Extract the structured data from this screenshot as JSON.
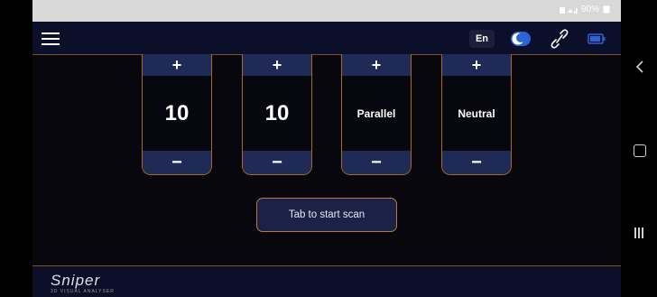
{
  "status_bar": {
    "status_text": "90%"
  },
  "app_bar": {
    "language": "En"
  },
  "tiles": [
    {
      "plus": "+",
      "value": "10",
      "minus": "−"
    },
    {
      "plus": "+",
      "value": "10",
      "minus": "−"
    },
    {
      "plus": "+",
      "value": "Parallel",
      "minus": "−"
    },
    {
      "plus": "+",
      "value": "Neutral",
      "minus": "−"
    }
  ],
  "scan_button": {
    "label": "Tab to start scan"
  },
  "footer": {
    "logo_name": "Sniper",
    "logo_tagline": "3D VISUAL ANALYSER"
  },
  "colors": {
    "accent": "#b8793a",
    "panel": "#1f2a56",
    "background": "#07070d"
  },
  "icons": [
    "menu-icon",
    "theme-toggle-icon",
    "link-icon",
    "battery-icon",
    "back-icon",
    "home-icon",
    "recents-icon"
  ]
}
